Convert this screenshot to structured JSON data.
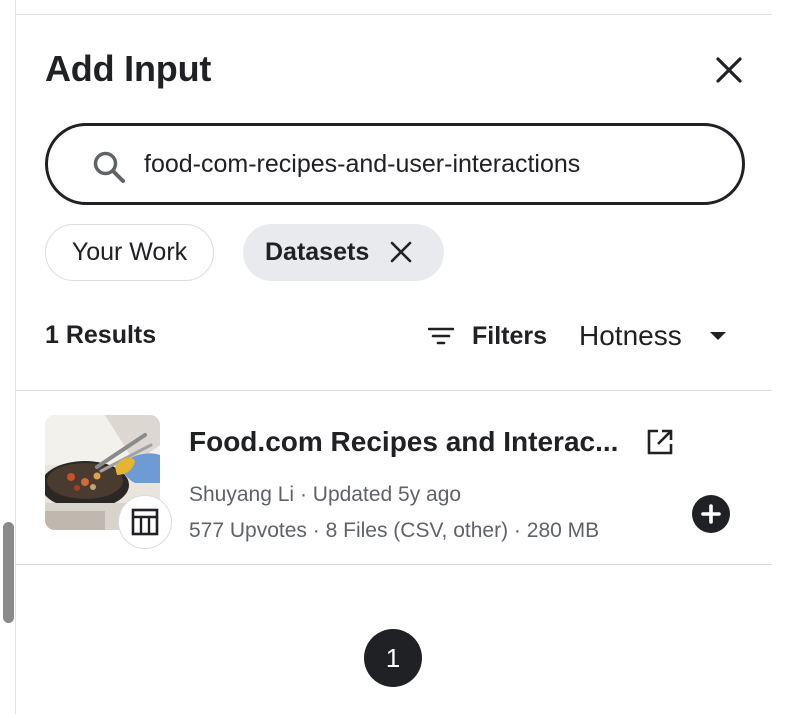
{
  "panel": {
    "title": "Add Input",
    "close_icon": "close-icon"
  },
  "search": {
    "value": "food-com-recipes-and-user-interactions",
    "icon": "search-icon"
  },
  "chips": [
    {
      "label": "Your Work",
      "selected": false
    },
    {
      "label": "Datasets",
      "selected": true,
      "icon": "close-icon"
    }
  ],
  "results": {
    "count_label": "1 Results",
    "filters_label": "Filters",
    "filters_icon": "filter-icon",
    "sort_label": "Hotness",
    "sort_icon": "caret-down-icon",
    "items": [
      {
        "title": "Food.com Recipes and Interac...",
        "author": "Shuyang Li",
        "separator": "·",
        "updated": "Updated 5y ago",
        "upvotes": "577 Upvotes",
        "files": "8 Files (CSV, other)",
        "size": "280 MB",
        "type_icon": "dataset-table-icon",
        "link_icon": "external-link-icon",
        "add_icon": "add-circle-icon",
        "thumbnail": "cooking-wok-image"
      }
    ]
  },
  "pagination": {
    "current_page": "1"
  },
  "colors": {
    "text_primary": "#202124",
    "text_secondary": "#5f6368",
    "chip_selected_bg": "#e8eaed",
    "border": "#dadce0",
    "scrollbar": "#8a8a8a"
  }
}
